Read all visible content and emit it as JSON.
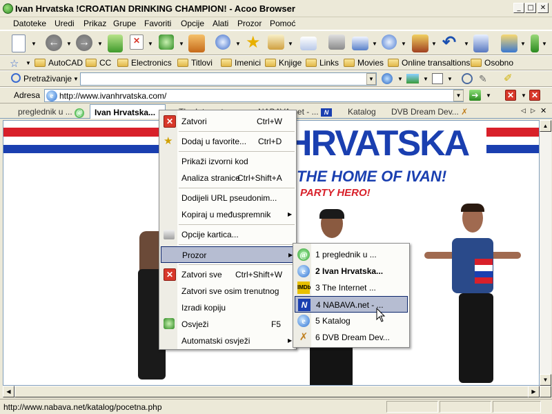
{
  "window": {
    "title": "Ivan Hrvatska !CROATIAN DRINKING CHAMPION! - Acoo Browser"
  },
  "menubar": [
    "Datoteke",
    "Uredi",
    "Prikaz",
    "Grupe",
    "Favoriti",
    "Opcije",
    "Alati",
    "Prozor",
    "Pomoć"
  ],
  "favorites": [
    "AutoCAD",
    "CC",
    "Electronics",
    "Titlovi",
    "Imenici",
    "Knjige",
    "Links",
    "Movies",
    "Online transaltions",
    "Osobno"
  ],
  "search": {
    "label": "Pretraživanje"
  },
  "address": {
    "label": "Adresa",
    "url": "http://www.ivanhrvatska.com/"
  },
  "tabs": [
    {
      "label": "preglednik u ..."
    },
    {
      "label": "Ivan Hrvatska..."
    },
    {
      "label": "The Internet ..."
    },
    {
      "label": "NABAVA.net - ..."
    },
    {
      "label": "Katalog"
    },
    {
      "label": "DVB Dream Dev..."
    }
  ],
  "page": {
    "headline": "HRVATSKA",
    "sub": "THE HOME OF IVAN!",
    "party": "PARTY HERO!"
  },
  "context_menu": [
    {
      "label": "Zatvori",
      "shortcut": "Ctrl+W"
    },
    {
      "label": "Dodaj u favorite...",
      "shortcut": "Ctrl+D"
    },
    {
      "label": "Prikaži izvorni kod",
      "shortcut": ""
    },
    {
      "label": "Analiza stranice",
      "shortcut": "Ctrl+Shift+A"
    },
    {
      "label": "Dodijeli URL pseudonim...",
      "shortcut": ""
    },
    {
      "label": "Kopiraj u međuspremnik",
      "shortcut": ""
    },
    {
      "label": "Opcije kartica...",
      "shortcut": ""
    },
    {
      "label": "Prozor",
      "shortcut": ""
    },
    {
      "label": "Zatvori sve",
      "shortcut": "Ctrl+Shift+W"
    },
    {
      "label": "Zatvori sve osim trenutnog",
      "shortcut": ""
    },
    {
      "label": "Izradi kopiju",
      "shortcut": ""
    },
    {
      "label": "Osvježi",
      "shortcut": "F5"
    },
    {
      "label": "Automatski osvježi",
      "shortcut": ""
    }
  ],
  "submenu": [
    {
      "label": "1 preglednik u ..."
    },
    {
      "label": "2 Ivan Hrvatska..."
    },
    {
      "label": "3 The Internet ..."
    },
    {
      "label": "4 NABAVA.net - ..."
    },
    {
      "label": "5 Katalog"
    },
    {
      "label": "6 DVB Dream Dev..."
    }
  ],
  "status": {
    "text": "http://www.nabava.net/katalog/pocetna.php"
  },
  "colors": {
    "highlight": "#b6bdd2",
    "brand_blue": "#1a3fb0",
    "brand_red": "#d8202a"
  }
}
